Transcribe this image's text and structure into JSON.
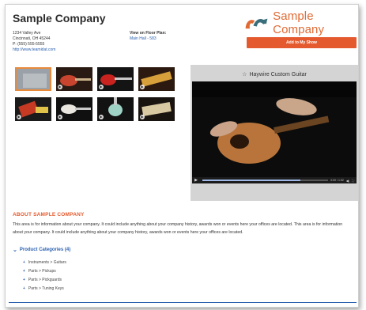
{
  "company": {
    "name": "Sample Company",
    "address_line1": "1234 Valley Ave",
    "address_line2": "Cincinnati, OH 45244",
    "phone": "P: (555) 555-5555",
    "website": "http://www.teamidat.com"
  },
  "floor_plan": {
    "label": "View on Floor Plan:",
    "value": "Main Hall - 583"
  },
  "logo": {
    "text": "Sample Company",
    "accent": "#e06a33",
    "accent2": "#3a6e7a"
  },
  "add_button": {
    "label": "Add to My Show",
    "color": "#e45a2e"
  },
  "gallery": {
    "thumbnails": [
      {
        "name": "thumb-1",
        "selected": true
      },
      {
        "name": "thumb-2"
      },
      {
        "name": "thumb-3"
      },
      {
        "name": "thumb-4"
      },
      {
        "name": "thumb-5"
      },
      {
        "name": "thumb-6"
      },
      {
        "name": "thumb-7"
      },
      {
        "name": "thumb-8"
      }
    ],
    "thumb_icon": "play-icon"
  },
  "video": {
    "title": "Haywire Custom Guitar",
    "time": "0:00 / 1:32",
    "progress": 0.78
  },
  "about": {
    "heading": "ABOUT SAMPLE COMPANY",
    "text": "This area is for information about your company. It could include anything about your company history, awards won or events here your offices are located. This area is for information about your company. It could include anything about your company history, awards won or events here your offices are located."
  },
  "categories": {
    "heading": "Product Categories (4)",
    "items": [
      "Instruments > Guitars",
      "Parts > Pickups",
      "Parts > Pickguards",
      "Parts > Tuning Keys"
    ]
  }
}
